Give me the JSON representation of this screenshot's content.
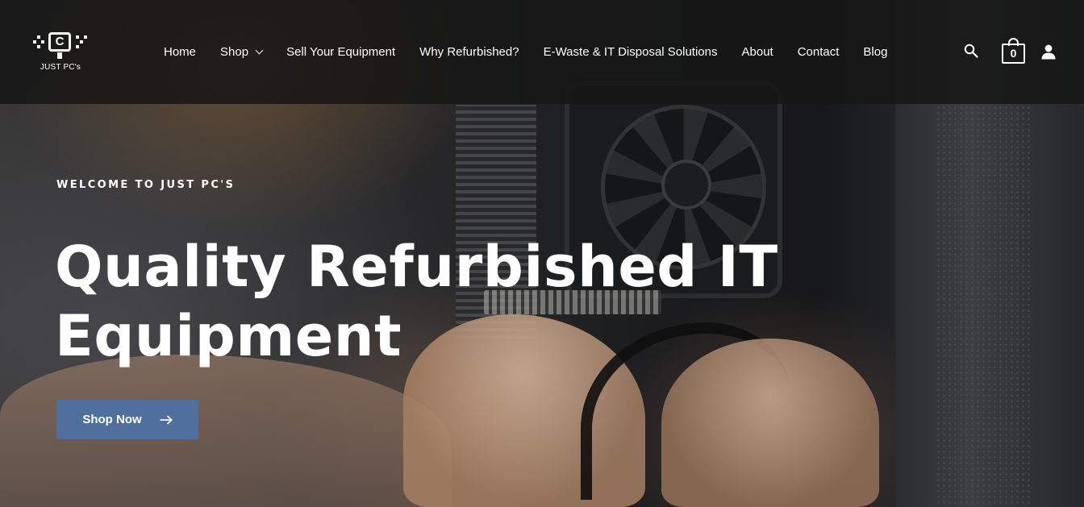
{
  "brand": {
    "logo_letter": "C",
    "logo_text": "JUST PC's"
  },
  "nav": {
    "items": [
      {
        "label": "Home",
        "has_dropdown": false
      },
      {
        "label": "Shop",
        "has_dropdown": true
      },
      {
        "label": "Sell Your Equipment",
        "has_dropdown": false
      },
      {
        "label": "Why Refurbished?",
        "has_dropdown": false
      },
      {
        "label": "E-Waste & IT Disposal Solutions",
        "has_dropdown": false
      },
      {
        "label": "About",
        "has_dropdown": false
      },
      {
        "label": "Contact",
        "has_dropdown": false
      },
      {
        "label": "Blog",
        "has_dropdown": false
      }
    ]
  },
  "header_actions": {
    "search_icon": "search-icon",
    "cart_icon": "shopping-bag-icon",
    "cart_count": "0",
    "account_icon": "user-icon"
  },
  "hero": {
    "eyebrow": "WELCOME TO JUST PC'S",
    "headline": "Quality Refurbished IT Equipment",
    "cta_label": "Shop Now",
    "cta_icon": "arrow-right-icon"
  },
  "colors": {
    "header_bg": "#161616",
    "cta_bg": "#4f709c",
    "text": "#ffffff"
  }
}
